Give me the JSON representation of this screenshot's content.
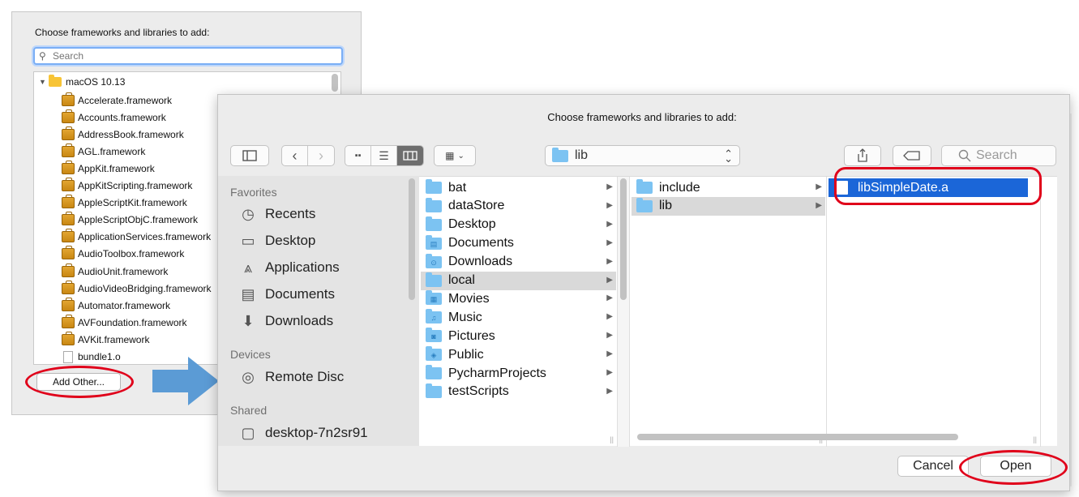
{
  "left_dialog": {
    "title": "Choose frameworks and libraries to add:",
    "search_placeholder": "Search",
    "root": "macOS 10.13",
    "items": [
      {
        "label": "Accelerate.framework",
        "kind": "framework"
      },
      {
        "label": "Accounts.framework",
        "kind": "framework"
      },
      {
        "label": "AddressBook.framework",
        "kind": "framework"
      },
      {
        "label": "AGL.framework",
        "kind": "framework"
      },
      {
        "label": "AppKit.framework",
        "kind": "framework"
      },
      {
        "label": "AppKitScripting.framework",
        "kind": "framework"
      },
      {
        "label": "AppleScriptKit.framework",
        "kind": "framework"
      },
      {
        "label": "AppleScriptObjC.framework",
        "kind": "framework"
      },
      {
        "label": "ApplicationServices.framework",
        "kind": "framework"
      },
      {
        "label": "AudioToolbox.framework",
        "kind": "framework"
      },
      {
        "label": "AudioUnit.framework",
        "kind": "framework"
      },
      {
        "label": "AudioVideoBridging.framework",
        "kind": "framework"
      },
      {
        "label": "Automator.framework",
        "kind": "framework"
      },
      {
        "label": "AVFoundation.framework",
        "kind": "framework"
      },
      {
        "label": "AVKit.framework",
        "kind": "framework"
      },
      {
        "label": "bundle1.o",
        "kind": "file"
      }
    ],
    "add_other_label": "Add Other..."
  },
  "dialog": {
    "title": "Choose frameworks and libraries to add:",
    "path_label": "lib",
    "search_placeholder": "Search",
    "sidebar": {
      "favorites_header": "Favorites",
      "favorites": [
        {
          "label": "Recents",
          "icon": "clock-icon"
        },
        {
          "label": "Desktop",
          "icon": "desktop-icon"
        },
        {
          "label": "Applications",
          "icon": "applications-icon"
        },
        {
          "label": "Documents",
          "icon": "documents-icon"
        },
        {
          "label": "Downloads",
          "icon": "downloads-icon"
        }
      ],
      "devices_header": "Devices",
      "devices": [
        {
          "label": "Remote Disc",
          "icon": "disc-icon"
        }
      ],
      "shared_header": "Shared",
      "shared": [
        {
          "label": "desktop-7n2sr91",
          "icon": "computer-icon"
        }
      ]
    },
    "column1": [
      {
        "label": "bat",
        "glyph": ""
      },
      {
        "label": "dataStore",
        "glyph": ""
      },
      {
        "label": "Desktop",
        "glyph": ""
      },
      {
        "label": "Documents",
        "glyph": "▤"
      },
      {
        "label": "Downloads",
        "glyph": "⊙"
      },
      {
        "label": "local",
        "glyph": "",
        "selected": true
      },
      {
        "label": "Movies",
        "glyph": "▦"
      },
      {
        "label": "Music",
        "glyph": "♫"
      },
      {
        "label": "Pictures",
        "glyph": "◙"
      },
      {
        "label": "Public",
        "glyph": "◈"
      },
      {
        "label": "PycharmProjects",
        "glyph": ""
      },
      {
        "label": "testScripts",
        "glyph": ""
      }
    ],
    "column2": [
      {
        "label": "include"
      },
      {
        "label": "lib",
        "selected": true
      }
    ],
    "column3": [
      {
        "label": "libSimpleDate.a",
        "selected": true
      }
    ],
    "cancel_label": "Cancel",
    "open_label": "Open"
  },
  "colors": {
    "selection_blue": "#1b66d8",
    "folder_blue": "#7cc3f2",
    "annotation_red": "#e0001a",
    "arrow_blue": "#5b9bd5"
  }
}
